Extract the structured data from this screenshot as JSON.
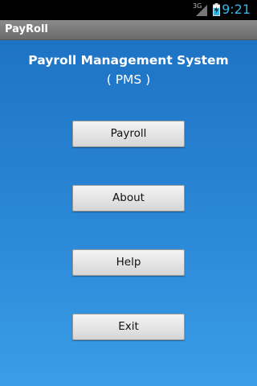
{
  "status_bar": {
    "network": "3G",
    "time": "9:21",
    "battery_color": "#33b5e5"
  },
  "title_bar": {
    "title": "PayRoll"
  },
  "main": {
    "heading": "Payroll Management System",
    "subheading": "( PMS )",
    "buttons": [
      {
        "label": "Payroll"
      },
      {
        "label": "About"
      },
      {
        "label": "Help"
      },
      {
        "label": "Exit"
      }
    ]
  },
  "colors": {
    "background_top": "#1e73c4",
    "background_bottom": "#3a9de6",
    "accent": "#33b5e5"
  }
}
